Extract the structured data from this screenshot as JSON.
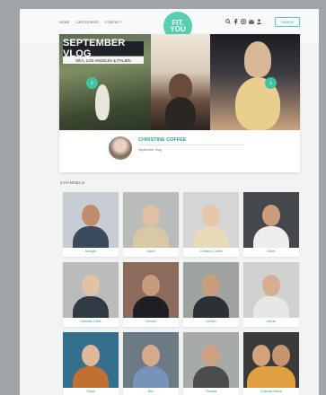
{
  "nav": {
    "links": [
      "Home",
      "Categories",
      "Contact"
    ],
    "logo_lines": [
      "FIT.",
      "YOU"
    ],
    "signin_label": "Sign in",
    "icons": [
      "search-icon",
      "facebook-icon",
      "instagram-icon",
      "email-icon",
      "user-icon"
    ]
  },
  "featured": {
    "title": "SEPTEMBER VLOG",
    "subtitle": "MCA, LOS ANGELES & ITALIEN",
    "author_name": "CHRISTINE COFFEE",
    "author_sub": "September Vlog"
  },
  "channels": {
    "title": "CHANNELS",
    "items": [
      {
        "name": "Morgan"
      },
      {
        "name": "Sarah"
      },
      {
        "name": "Christine Coffee"
      },
      {
        "name": "Oliver"
      },
      {
        "name": "Nathalie Class"
      },
      {
        "name": "Hernan"
      },
      {
        "name": "Jochen"
      },
      {
        "name": "Adrian"
      },
      {
        "name": "Sarah"
      },
      {
        "name": "Neo"
      },
      {
        "name": "Thomas"
      },
      {
        "name": "Channel Name"
      }
    ]
  },
  "colors": {
    "accent": "#3ec4a2",
    "accent_text": "#2aa886"
  }
}
